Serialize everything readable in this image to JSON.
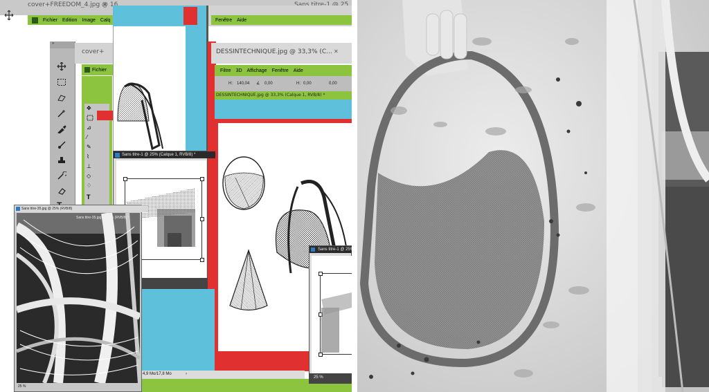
{
  "colors": {
    "accent_green": "#8dc43f",
    "cyan": "#5fc0dc",
    "red": "#e03030",
    "toolbar_gray": "#c8c8c8",
    "photo_gray": "#d6d6d6"
  },
  "tabs": {
    "tab1": "cover+FREEDOM_4.jpg @ 16",
    "tab1_close": "✕",
    "tab2": "Sans titre-1 @ 25",
    "tab3": "cover+",
    "tab4": "DESSINTECHNIQUE.jpg @ 33,3% (C...",
    "tab4_close": "✕",
    "tab_back": "cover+FREEDOM_4.jpg @ 16,"
  },
  "menus": {
    "top": [
      "Fichier",
      "Edition",
      "Image",
      "Calq"
    ],
    "top_right": [
      "Fenêtre",
      "Aide"
    ],
    "second": [
      "Fichier"
    ],
    "third": [
      "Filtre",
      "3D",
      "Affichage",
      "Fenêtre",
      "Aide"
    ]
  },
  "options_bar": {
    "h_label": "H:",
    "h_value": "140,04",
    "angle_value": "0,00",
    "h2_label": "H:",
    "h2_value": "0,00",
    "v_value": "0,00"
  },
  "doc_tab": "DESSINTECHNIQUE.jpg @ 33,3% (Calque 1, RVB/8) *",
  "windows": {
    "sans1_title": "Sans titre-1 @ 25% (Calque 1, RVB/8) *",
    "sans35_title": "Sans titre-35.jpg @ 25% (RVB/8)",
    "sans35_inner_title": "Sans titre-35.jpg @ 25% (RVB/8) *",
    "sans35_zoom": "25 %",
    "sans1b_title": "Sans titre-1 @ 25% (Calque 1, RVB/8) *",
    "sans1b_zoom": "25 %"
  },
  "status": {
    "doc_size": "4,9 Mo/17,8 Mo"
  },
  "icons": [
    "move-tool-icon",
    "marquee-icon",
    "lasso-icon",
    "magic-wand-icon",
    "eyedropper-icon",
    "brush-icon",
    "stamp-icon",
    "history-brush-icon",
    "eraser-icon",
    "type-icon"
  ]
}
